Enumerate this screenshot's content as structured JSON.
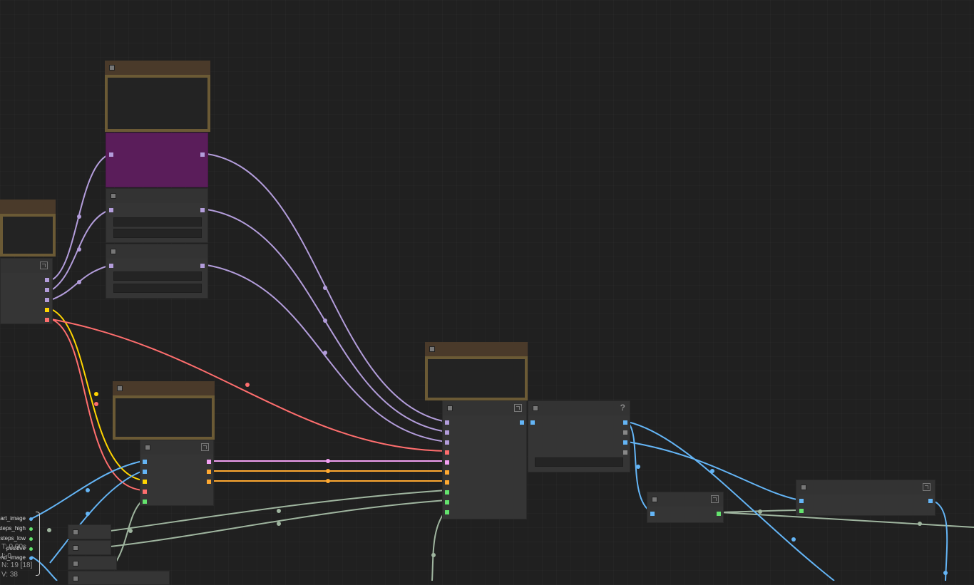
{
  "colors": {
    "latent": "#b39ddb",
    "clip": "#ffd500",
    "vae": "#ff6e6e",
    "conditioning": "#ffa931",
    "image": "#64b5f6",
    "int": "#64e36e",
    "mask": "#9fb59f",
    "pink": "#f3a0f3"
  },
  "input_labels": [
    "art_image",
    "steps_high",
    "steps_low",
    "positive",
    "end_image"
  ],
  "stats": {
    "t": "T: 0.00s",
    "i": "I: 0",
    "n": "N: 19 [18]",
    "v": "V: 38"
  },
  "icons": {
    "collapse": "collapse-dot-icon",
    "expand": "expand-icon",
    "help": "?"
  }
}
